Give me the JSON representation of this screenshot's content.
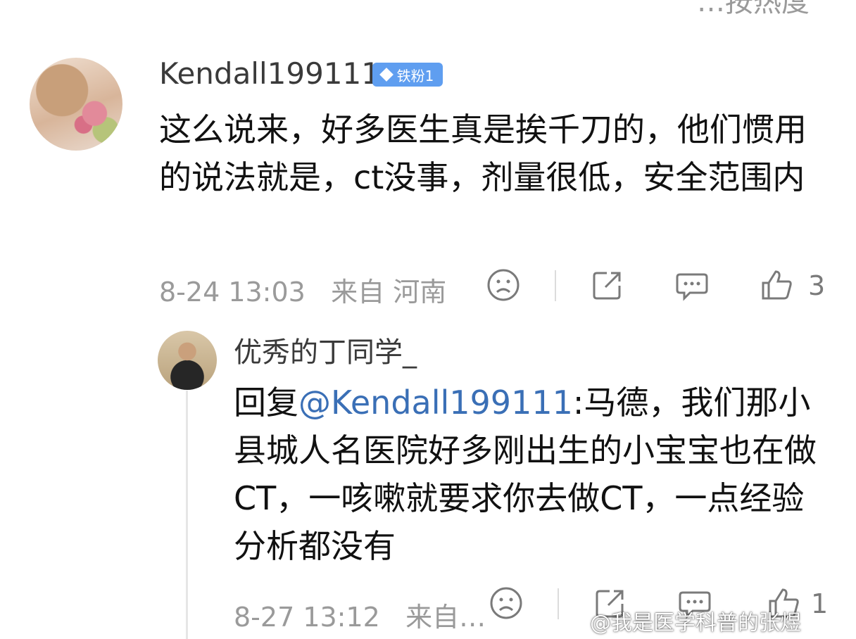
{
  "top_partial_text": "…按热度",
  "main_comment": {
    "username": "Kendall199111",
    "badge": "铁粉1",
    "text": "这么说来，好多医生真是挨千刀的，他们惯用的说法就是，ct没事，剂量很低，安全范围内",
    "date": "8-24 13:03",
    "location": "来自 河南",
    "like_count": "3",
    "icons": [
      "sad-face-icon",
      "share-icon",
      "comment-icon",
      "thumbs-up-icon"
    ]
  },
  "reply": {
    "username": "优秀的丁同学_",
    "prefix": "回复",
    "mention": "@Kendall199111",
    "text": ":马德，我们那小县城人名医院好多刚出生的小宝宝也在做CT，一咳嗽就要求你去做CT，一点经验分析都没有",
    "date": "8-27 13:12",
    "location": "来自…",
    "like_count": "1",
    "icons": [
      "sad-face-icon",
      "share-icon",
      "comment-icon",
      "thumbs-up-icon"
    ]
  },
  "watermark": "@我是医学科普的张煜",
  "colors": {
    "badge_bg": "#5f9ef0",
    "mention": "#3a6fb6",
    "meta_gray": "#9a9a9a",
    "icon_gray": "#7a7a7a"
  }
}
